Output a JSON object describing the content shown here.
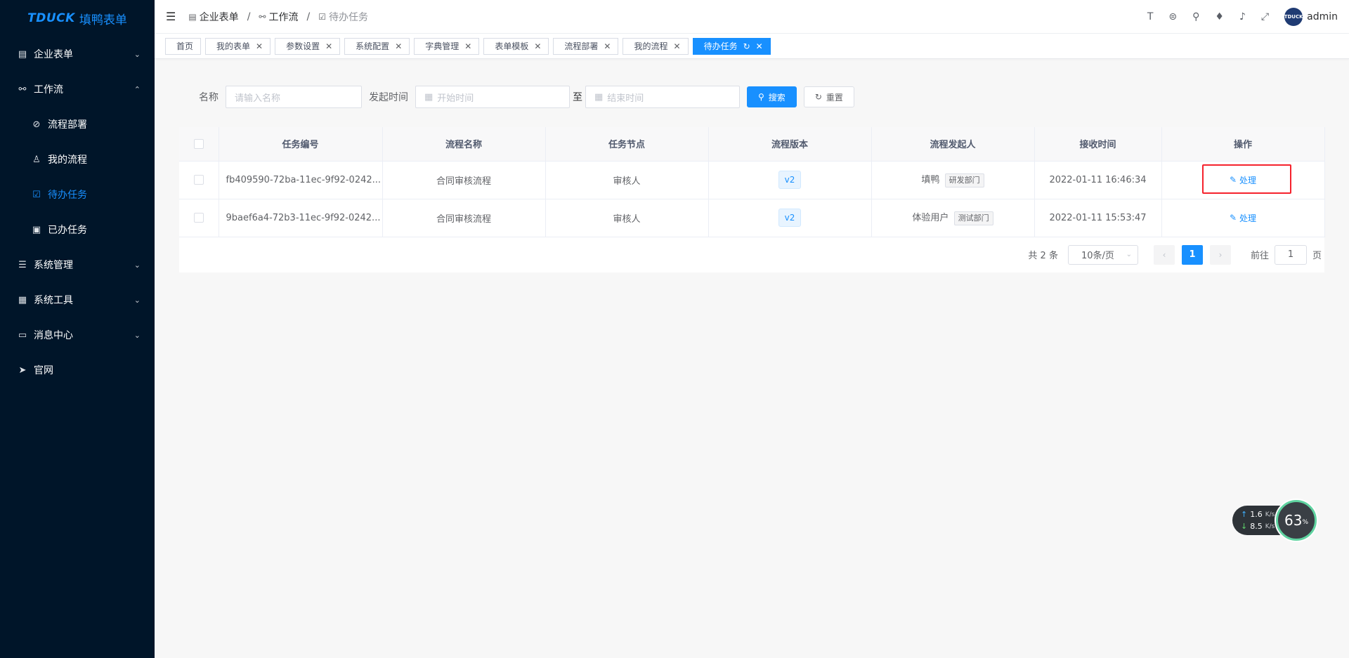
{
  "app": {
    "brand": "TDUCK",
    "brand_cn": "填鸭表单",
    "avatar_text": "TDUCK"
  },
  "sidebar": {
    "items": [
      {
        "label": "企业表单",
        "icon": "clipboard-icon",
        "arrow": "⌄"
      },
      {
        "label": "工作流",
        "icon": "workflow-icon",
        "arrow": "⌃"
      },
      {
        "label": "流程部署",
        "icon": "deploy-icon"
      },
      {
        "label": "我的流程",
        "icon": "user-icon"
      },
      {
        "label": "待办任务",
        "icon": "checkbox-icon"
      },
      {
        "label": "已办任务",
        "icon": "document-icon"
      },
      {
        "label": "系统管理",
        "icon": "list-icon",
        "arrow": "⌄"
      },
      {
        "label": "系统工具",
        "icon": "toolbox-icon",
        "arrow": "⌄"
      },
      {
        "label": "消息中心",
        "icon": "message-icon",
        "arrow": "⌄"
      },
      {
        "label": "官网",
        "icon": "send-icon"
      }
    ]
  },
  "breadcrumb": {
    "items": [
      "企业表单",
      "工作流",
      "待办任务"
    ],
    "sep": "/"
  },
  "header": {
    "user": "admin"
  },
  "tags": [
    {
      "label": "首页"
    },
    {
      "label": "我的表单"
    },
    {
      "label": "参数设置"
    },
    {
      "label": "系统配置"
    },
    {
      "label": "字典管理"
    },
    {
      "label": "表单模板"
    },
    {
      "label": "流程部署"
    },
    {
      "label": "我的流程"
    },
    {
      "label": "待办任务"
    }
  ],
  "search": {
    "name_label": "名称",
    "name_placeholder": "请输入名称",
    "time_label": "发起时间",
    "start_placeholder": "开始时间",
    "range_sep": "至",
    "end_placeholder": "结束时间",
    "search_btn": "搜索",
    "reset_btn": "重置"
  },
  "table": {
    "headers": [
      "任务编号",
      "流程名称",
      "任务节点",
      "流程版本",
      "流程发起人",
      "接收时间",
      "操作"
    ],
    "rows": [
      {
        "id": "fb409590-72ba-11ec-9f92-0242...",
        "flow": "合同审核流程",
        "node": "审核人",
        "version": "v2",
        "starter": "填鸭",
        "dept": "研发部门",
        "time": "2022-01-11 16:46:34",
        "op": "处理"
      },
      {
        "id": "9baef6a4-72b3-11ec-9f92-0242...",
        "flow": "合同审核流程",
        "node": "审核人",
        "version": "v2",
        "starter": "体验用户",
        "dept": "测试部门",
        "time": "2022-01-11 15:53:47",
        "op": "处理"
      }
    ]
  },
  "pagination": {
    "total": "共 2 条",
    "page_size": "10条/页",
    "current": "1",
    "goto_label": "前往",
    "goto_value": "1",
    "page_unit": "页"
  },
  "net_widget": {
    "up": "1.6",
    "up_unit": "K/s",
    "down": "8.5",
    "down_unit": "K/s",
    "percent": "63",
    "percent_unit": "%"
  },
  "colors": {
    "primary": "#1890ff",
    "sidebar_bg": "#001529",
    "highlight": "#f5222d"
  }
}
